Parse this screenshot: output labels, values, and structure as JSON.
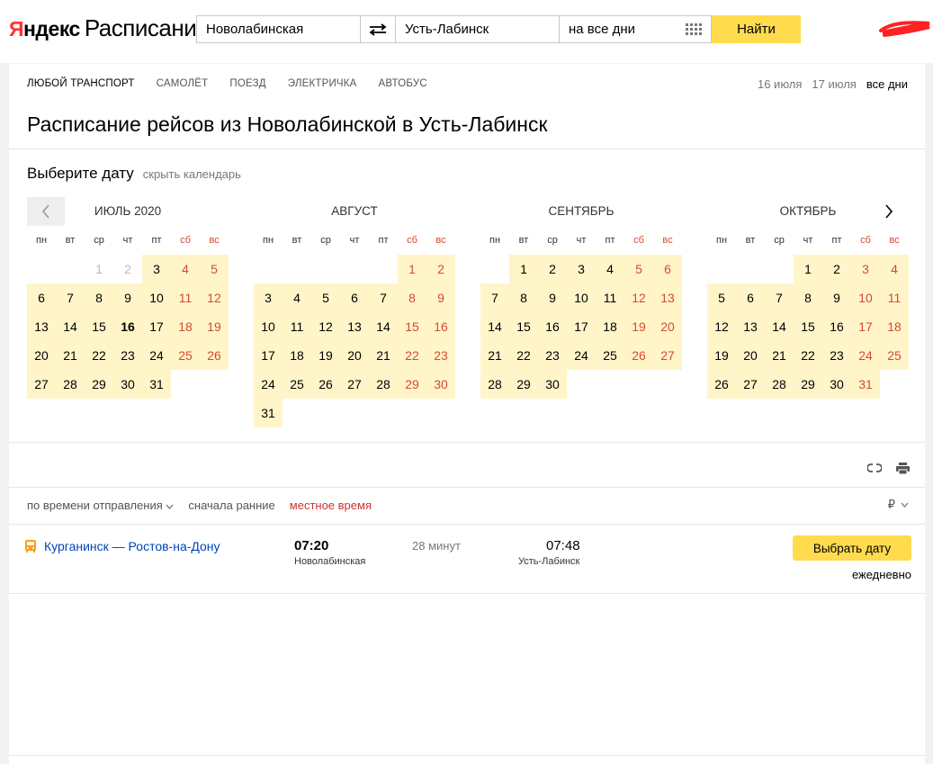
{
  "header": {
    "logo_yandex_first": "Я",
    "logo_yandex_rest": "ндекс",
    "logo_product": "Расписания",
    "from_value": "Новолабинская",
    "to_value": "Усть-Лабинск",
    "date_value": "на все дни",
    "find_label": "Найти"
  },
  "transport_tabs": [
    "Любой транспорт",
    "Самолёт",
    "Поезд",
    "Электричка",
    "Автобус"
  ],
  "date_links": [
    "16 июля",
    "17 июля",
    "все дни"
  ],
  "page_title": "Расписание рейсов из Новолабинской в Усть-Лабинск",
  "calendar": {
    "heading": "Выберите дату",
    "hide_label": "скрыть календарь",
    "weekdays": [
      "пн",
      "вт",
      "ср",
      "чт",
      "пт",
      "сб",
      "вс"
    ],
    "months": [
      {
        "title": "Июль 2020",
        "offset": 2,
        "length": 31,
        "first_available": 3,
        "today": 16
      },
      {
        "title": "Август",
        "offset": 5,
        "length": 31,
        "first_available": 1,
        "today": 0
      },
      {
        "title": "Сентябрь",
        "offset": 1,
        "length": 30,
        "first_available": 1,
        "today": 0
      },
      {
        "title": "Октябрь",
        "offset": 3,
        "length": 31,
        "first_available": 1,
        "today": 0
      }
    ]
  },
  "sort": {
    "by_departure": "по времени отправления",
    "earliest_first": "сначала ранние",
    "local_time": "местное время",
    "currency": "₽"
  },
  "trip": {
    "route": "Курганинск — Ростов-на-Дону",
    "departure_time": "07:20",
    "departure_station": "Новолабинская",
    "duration": "28 минут",
    "arrival_time": "07:48",
    "arrival_station": "Усть-Лабинск",
    "button_label": "Выбрать дату",
    "frequency": "ежедневно"
  },
  "colors": {
    "accent_yellow": "#ffdb4d",
    "available_day": "#fff5c9",
    "weekend_red": "#d64933",
    "link_blue": "#0044bb"
  }
}
